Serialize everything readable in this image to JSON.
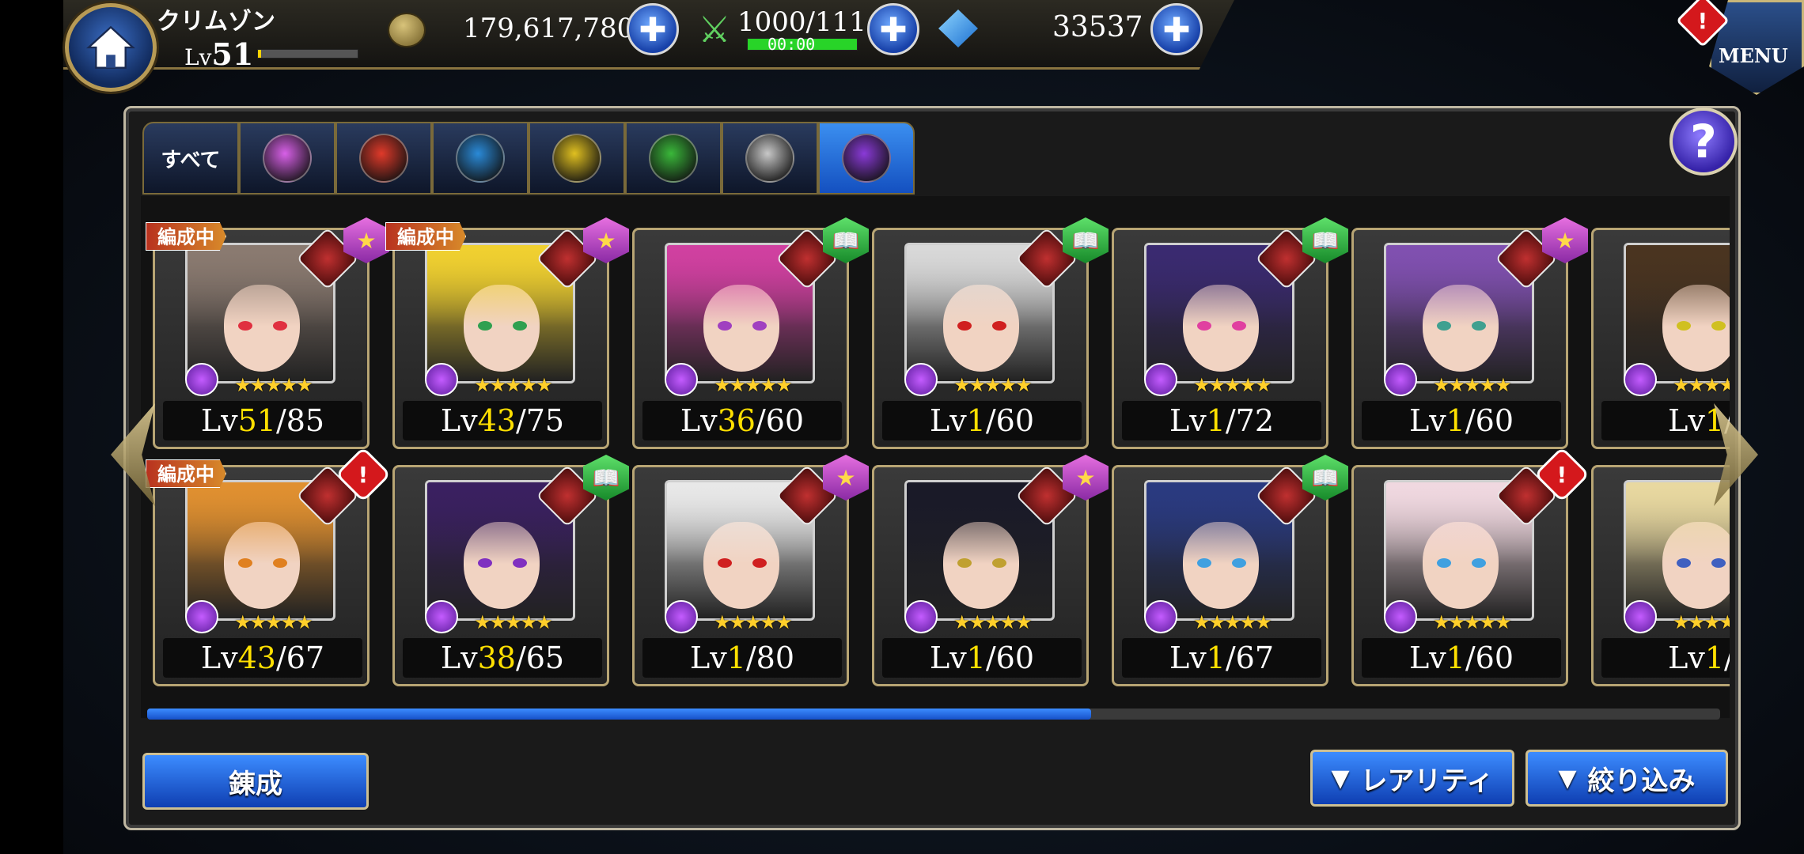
{
  "player": {
    "name": "クリムゾン",
    "lv_prefix": "Lv",
    "level": "51",
    "exp_fraction": 0.03
  },
  "currency": {
    "coins": "179,617,780",
    "stamina": "1000/111",
    "stamina_timer": "00:00",
    "stamina_fraction": 1.0,
    "gems": "33537"
  },
  "menu": {
    "label": "MENU"
  },
  "help": {
    "label": "?"
  },
  "filter_tabs": [
    {
      "label": "すべて",
      "icon": "all"
    },
    {
      "label": "",
      "icon": "star-attribute-icon",
      "color": "#d860e8"
    },
    {
      "label": "",
      "icon": "fire-attribute-icon",
      "color": "#e03a2a"
    },
    {
      "label": "",
      "icon": "water-attribute-icon",
      "color": "#2a8ad8"
    },
    {
      "label": "",
      "icon": "thunder-attribute-icon",
      "color": "#e0c020"
    },
    {
      "label": "",
      "icon": "wind-attribute-icon",
      "color": "#3ab83a"
    },
    {
      "label": "",
      "icon": "light-attribute-icon",
      "color": "#c8c8c8"
    },
    {
      "label": "",
      "icon": "dark-attribute-icon",
      "color": "#8a3ad8",
      "active": true
    }
  ],
  "cards": [
    {
      "formation": "編成中",
      "lv": "Lv",
      "cur": "51",
      "max": "/85",
      "badge": "star",
      "hair": "#8a7a70",
      "eye": "#e03040"
    },
    {
      "formation": "編成中",
      "lv": "Lv",
      "cur": "43",
      "max": "/75",
      "badge": "star",
      "hair": "#f0d030",
      "eye": "#30a050"
    },
    {
      "formation": "",
      "lv": "Lv",
      "cur": "36",
      "max": "/60",
      "badge": "book",
      "hair": "#d040a0",
      "eye": "#a040c0"
    },
    {
      "formation": "",
      "lv": "Lv",
      "cur": "1",
      "max": "/60",
      "badge": "book",
      "hair": "#d8d8d8",
      "eye": "#d02020"
    },
    {
      "formation": "",
      "lv": "Lv",
      "cur": "1",
      "max": "/72",
      "badge": "book",
      "hair": "#3a2a70",
      "eye": "#e040a0"
    },
    {
      "formation": "",
      "lv": "Lv",
      "cur": "1",
      "max": "/60",
      "badge": "star",
      "hair": "#8050b0",
      "eye": "#40a090"
    },
    {
      "formation": "",
      "lv": "Lv",
      "cur": "1",
      "max": "/",
      "badge": "",
      "hair": "#4a3420",
      "eye": "#d0c020"
    },
    {
      "formation": "編成中",
      "lv": "Lv",
      "cur": "43",
      "max": "/67",
      "badge": "alert",
      "hair": "#e09030",
      "eye": "#e08020"
    },
    {
      "formation": "",
      "lv": "Lv",
      "cur": "38",
      "max": "/65",
      "badge": "book",
      "hair": "#3a2060",
      "eye": "#8030c0"
    },
    {
      "formation": "",
      "lv": "Lv",
      "cur": "1",
      "max": "/80",
      "badge": "star",
      "hair": "#e8e8e8",
      "eye": "#d02020"
    },
    {
      "formation": "",
      "lv": "Lv",
      "cur": "1",
      "max": "/60",
      "badge": "star",
      "hair": "#1a1a28",
      "eye": "#c0a030"
    },
    {
      "formation": "",
      "lv": "Lv",
      "cur": "1",
      "max": "/67",
      "badge": "book",
      "hair": "#2a3a80",
      "eye": "#40a0e0"
    },
    {
      "formation": "",
      "lv": "Lv",
      "cur": "1",
      "max": "/60",
      "badge": "alert",
      "hair": "#f0d8e0",
      "eye": "#40a0e0"
    },
    {
      "formation": "",
      "lv": "Lv",
      "cur": "1",
      "max": "/",
      "badge": "",
      "hair": "#e8d8a0",
      "eye": "#4060c0"
    }
  ],
  "scroll_fraction": 0.6,
  "buttons": {
    "synthesize": "錬成",
    "rarity": "レアリティ",
    "filter": "絞り込み"
  }
}
